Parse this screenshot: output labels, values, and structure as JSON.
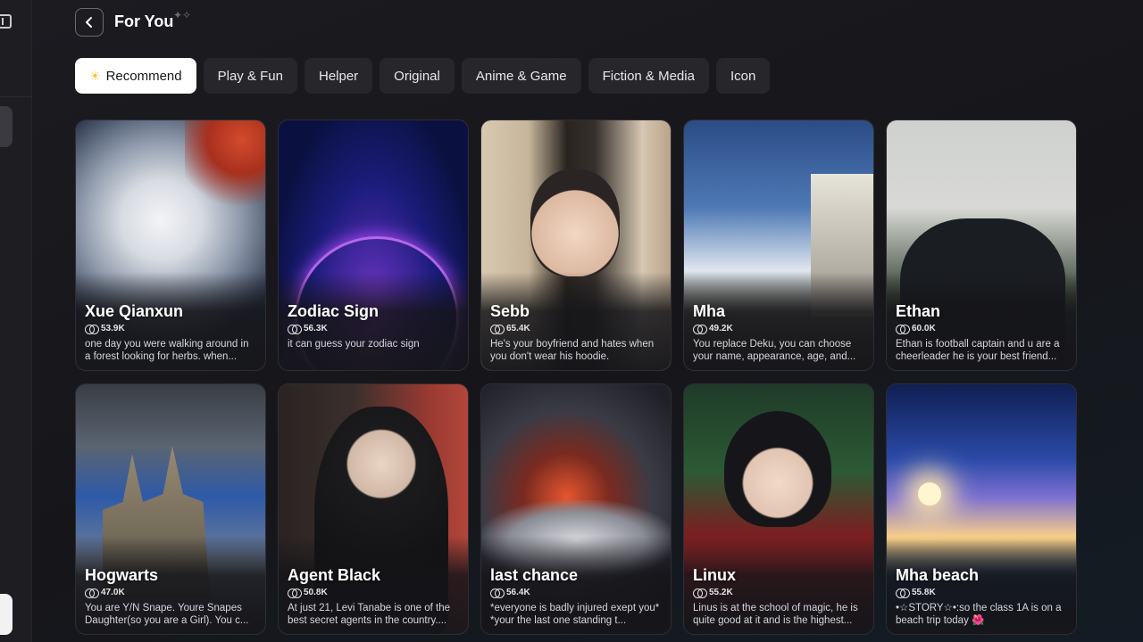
{
  "header": {
    "title": "For You"
  },
  "tabs": [
    {
      "label": "Recommend",
      "active": true,
      "icon": "sun-icon"
    },
    {
      "label": "Play & Fun",
      "active": false
    },
    {
      "label": "Helper",
      "active": false
    },
    {
      "label": "Original",
      "active": false
    },
    {
      "label": "Anime & Game",
      "active": false
    },
    {
      "label": "Fiction & Media",
      "active": false
    },
    {
      "label": "Icon",
      "active": false
    }
  ],
  "cards": [
    {
      "name": "Xue Qianxun",
      "chats": "53.9K",
      "description": "one day you were walking around in a forest looking for herbs. when..."
    },
    {
      "name": "Zodiac Sign",
      "chats": "56.3K",
      "description": "it can guess your zodiac sign"
    },
    {
      "name": "Sebb",
      "chats": "65.4K",
      "description": "He's your boyfriend and hates when you don't wear his hoodie."
    },
    {
      "name": "Mha",
      "chats": "49.2K",
      "description": "You replace Deku, you can choose your name, appearance, age, and..."
    },
    {
      "name": "Ethan",
      "chats": "60.0K",
      "description": "Ethan is football captain and u are a cheerleader he is your best friend..."
    },
    {
      "name": "Hogwarts",
      "chats": "47.0K",
      "description": "You are Y/N Snape. Youre Snapes Daughter(so you are a Girl). You c..."
    },
    {
      "name": "Agent Black",
      "chats": "50.8K",
      "description": "At just 21, Levi Tanabe is one of the best secret agents in the country...."
    },
    {
      "name": "last chance",
      "chats": "56.4K",
      "description": "*everyone is badly injured exept you* *your the last one standing t..."
    },
    {
      "name": "Linux",
      "chats": "55.2K",
      "description": "Linus is at the school of magic, he is quite good at it and is the highest..."
    },
    {
      "name": "Mha beach",
      "chats": "55.8K",
      "description": "•☆STORY☆•:so the class 1A is on a beach trip today 🌺"
    }
  ],
  "colors": {
    "background": "#17171b",
    "tab": "#26262b",
    "tab_active": "#ffffff",
    "accent_sun": "#f6c53b"
  }
}
